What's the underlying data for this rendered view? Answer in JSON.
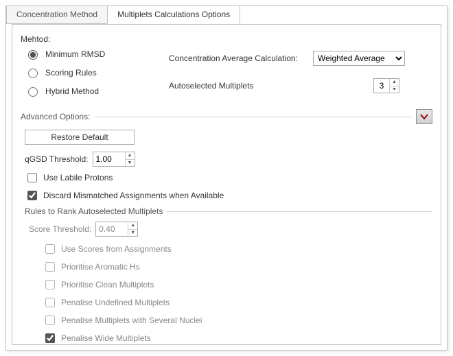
{
  "tabs": {
    "concentration_method": "Concentration Method",
    "multiplets_calc": "Multiplets Calculations Options"
  },
  "method": {
    "label": "Mehtod:",
    "min_rmsd": "Minimum RMSD",
    "scoring_rules": "Scoring Rules",
    "hybrid": "Hybrid Method"
  },
  "conc_avg": {
    "label": "Concentration Average Calculation:",
    "value": "Weighted Average"
  },
  "autoselect": {
    "label": "Autoselected Multiplets",
    "value": "3"
  },
  "advanced": {
    "label": "Advanced Options:",
    "restore": "Restore Default",
    "qgsd_label": "qGSD Threshold:",
    "qgsd_value": "1.00",
    "use_labile": "Use Labile Protons",
    "discard_mismatch": "Discard Mismatched Assignments when Available"
  },
  "rules": {
    "title": "Rules to Rank Autoselected Multiplets",
    "score_threshold_label": "Score Threshold:",
    "score_threshold_value": "0.40",
    "use_scores": "Use Scores from Assignments",
    "prioritise_aromatic": "Prioritise Aromatic Hs",
    "prioritise_clean": "Prioritise Clean Multiplets",
    "penalise_undefined": "Penalise Undefined Multiplets",
    "penalise_several": "Penalise Multiplets with Several Nuclei",
    "penalise_wide": "Penalise Wide Multiplets"
  }
}
